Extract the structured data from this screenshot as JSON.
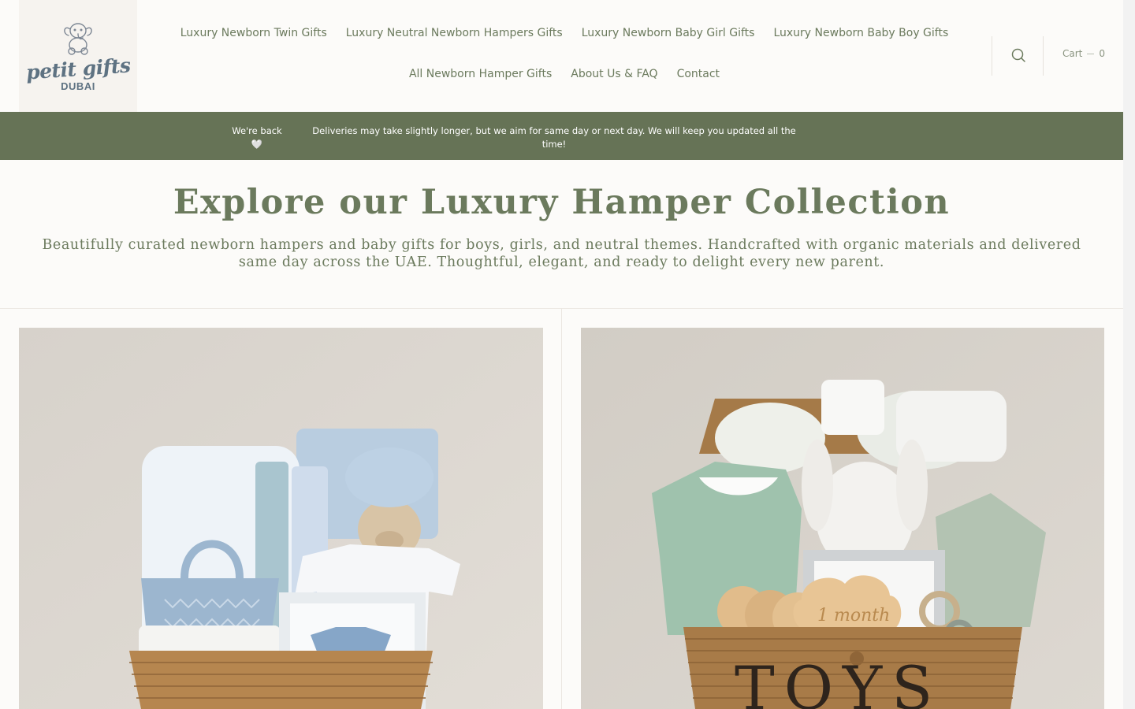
{
  "logo": {
    "script": "petit gifts",
    "subtitle": "DUBAI",
    "icon": "baby-elephant-icon"
  },
  "nav": {
    "row1": [
      {
        "label": "Luxury Newborn Twin Gifts"
      },
      {
        "label": "Luxury Neutral Newborn Hampers Gifts"
      },
      {
        "label": "Luxury Newborn Baby Girl Gifts"
      },
      {
        "label": "Luxury Newborn Baby Boy Gifts"
      }
    ],
    "row2": [
      {
        "label": "All Newborn Hamper Gifts"
      },
      {
        "label": "About Us & FAQ"
      },
      {
        "label": "Contact"
      }
    ]
  },
  "header": {
    "search_icon": "search-icon",
    "cart_label": "Cart",
    "cart_count": "0"
  },
  "announcement": {
    "left_text": "We're back",
    "left_emoji": "🤍",
    "main_text": "Deliveries may take slightly longer, but we aim for same day or next day. We will keep you updated all the time!"
  },
  "hero": {
    "title": "Explore our Luxury Hamper Collection",
    "subtitle": "Beautifully curated newborn hampers and baby gifts for boys, girls, and neutral themes. Handcrafted with organic materials and delivered same day across the UAE. Thoughtful, elegant, and ready to delight every new parent."
  },
  "products": [
    {
      "image": "blue-baby-boy-hamper-image",
      "accent": "#9cb6cf"
    },
    {
      "image": "neutral-mint-hamper-image",
      "accent": "#9fc2ad",
      "basket_text": "TOYS",
      "milestone_text": "1 month"
    }
  ],
  "colors": {
    "brand_green": "#667356",
    "text_green": "#6b7a5d",
    "logo_blue": "#5e7282",
    "background": "#fcfbf9"
  }
}
